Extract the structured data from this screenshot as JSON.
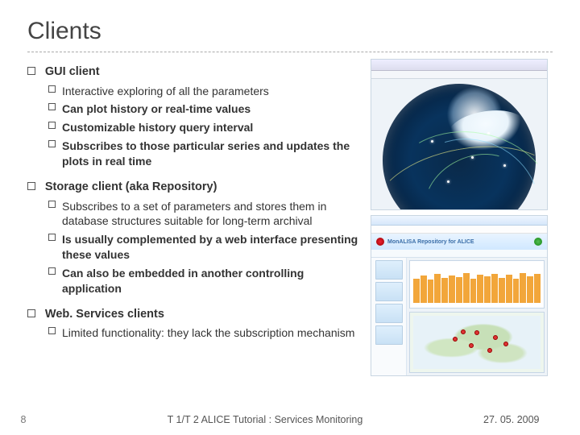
{
  "title": "Clients",
  "sections": [
    {
      "label": "GUI client",
      "items": [
        {
          "text": "Interactive exploring of all the parameters",
          "bold": false
        },
        {
          "text": "Can plot history or real-time values",
          "bold": true
        },
        {
          "text": "Customizable history query interval",
          "bold": true
        },
        {
          "text": "Subscribes to those particular series and updates the plots in real time",
          "bold": true
        }
      ]
    },
    {
      "label": "Storage client (aka Repository)",
      "items": [
        {
          "text": "Subscribes to a set of parameters and stores them in database structures suitable for long-term archival",
          "bold": false
        },
        {
          "text": "Is usually complemented by a web interface presenting these values",
          "bold": true
        },
        {
          "text": "Can also be embedded in another controlling application",
          "bold": true
        }
      ]
    },
    {
      "label": "Web. Services clients",
      "items": [
        {
          "text": "Limited functionality: they lack the subscription mechanism",
          "bold": false
        }
      ]
    }
  ],
  "screenshots": {
    "repo_title": "MonALISA Repository for ALICE"
  },
  "footer": {
    "page": "8",
    "center": "T 1/T 2 ALICE Tutorial : Services Monitoring",
    "date": "27. 05. 2009"
  }
}
